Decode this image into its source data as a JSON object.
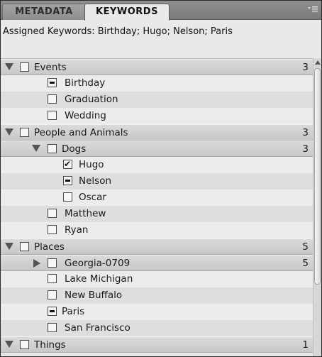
{
  "tabs": {
    "metadata": "METADATA",
    "keywords": "KEYWORDS"
  },
  "assigned_keywords": "Assigned Keywords: Birthday; Hugo; Nelson; Paris",
  "tree": {
    "events": {
      "label": "Events",
      "count": "3",
      "expanded": true,
      "state": "unchecked"
    },
    "birthday": {
      "label": "Birthday",
      "state": "partial"
    },
    "graduation": {
      "label": "Graduation",
      "state": "unchecked"
    },
    "wedding": {
      "label": "Wedding",
      "state": "unchecked"
    },
    "people": {
      "label": "People and Animals",
      "count": "3",
      "expanded": true,
      "state": "unchecked"
    },
    "dogs": {
      "label": "Dogs",
      "count": "3",
      "expanded": true,
      "state": "unchecked"
    },
    "hugo": {
      "label": "Hugo",
      "state": "checked"
    },
    "nelson": {
      "label": "Nelson",
      "state": "partial"
    },
    "oscar": {
      "label": "Oscar",
      "state": "unchecked"
    },
    "matthew": {
      "label": "Matthew",
      "state": "unchecked"
    },
    "ryan": {
      "label": "Ryan",
      "state": "unchecked"
    },
    "places": {
      "label": "Places",
      "count": "5",
      "expanded": true,
      "state": "unchecked"
    },
    "georgia": {
      "label": "Georgia-0709",
      "count": "5",
      "expanded": false,
      "state": "unchecked"
    },
    "lake_michigan": {
      "label": "Lake Michigan",
      "state": "unchecked"
    },
    "new_buffalo": {
      "label": "New Buffalo",
      "state": "unchecked"
    },
    "paris": {
      "label": "Paris",
      "state": "partial"
    },
    "san_francisco": {
      "label": "San Francisco",
      "state": "unchecked"
    },
    "things": {
      "label": "Things",
      "count": "1",
      "expanded": true,
      "state": "unchecked"
    }
  },
  "icons": {
    "panel_menu": "panel-menu-icon",
    "expand_open": "triangle-down-icon",
    "expand_closed": "triangle-right-icon",
    "scroll_up": "scroll-up-arrow-icon"
  },
  "colors": {
    "tabbar": "#7f7f7f",
    "panel_bg": "#e9e9e9",
    "parent_row": "#d0d0d0",
    "child_row_alt": "#dedede",
    "child_row": "#ececec"
  }
}
